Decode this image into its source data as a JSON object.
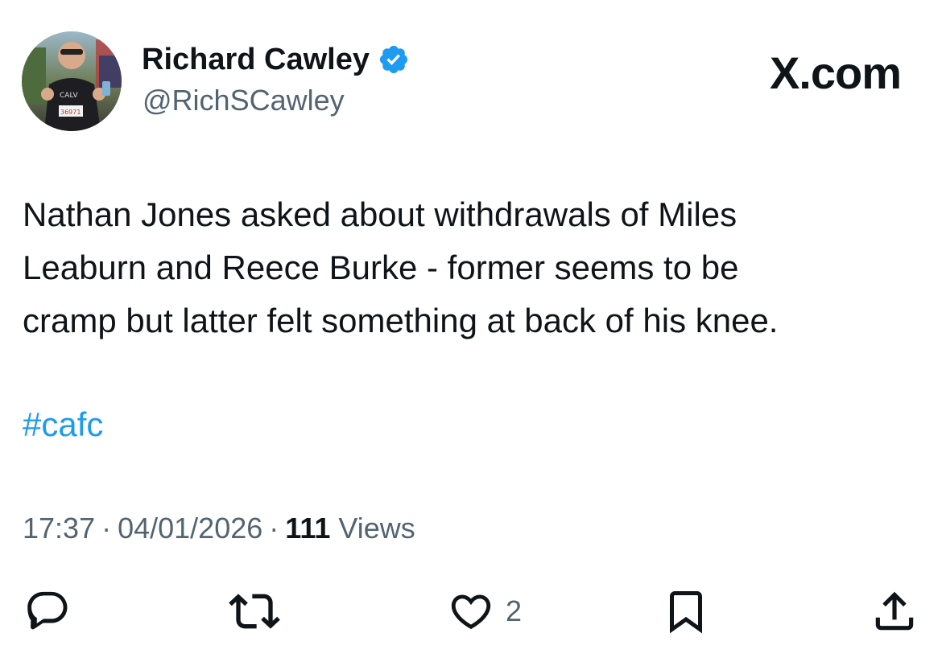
{
  "author": {
    "name": "Richard Cawley",
    "handle": "@RichSCawley",
    "verified_icon": "verified-badge-icon",
    "avatar_bib_number": "36971"
  },
  "brand": {
    "label": "X.com"
  },
  "tweet": {
    "lines": [
      "Nathan Jones asked about withdrawals of Miles",
      "Leaburn and Reece Burke - former seems to be",
      "cramp but latter felt something at back of his knee."
    ],
    "hashtag": "#cafc"
  },
  "meta": {
    "time": "17:37",
    "separator": "·",
    "date": "04/01/2026",
    "views_count": "111",
    "views_label": "Views"
  },
  "actions": {
    "reply_icon": "reply-icon",
    "retweet_icon": "retweet-icon",
    "like_icon": "heart-icon",
    "like_count": "2",
    "bookmark_icon": "bookmark-icon",
    "share_icon": "share-icon"
  },
  "colors": {
    "text": "#0f1419",
    "secondary": "#536471",
    "link": "#1d9bf0",
    "verified": "#1d9bf0"
  }
}
